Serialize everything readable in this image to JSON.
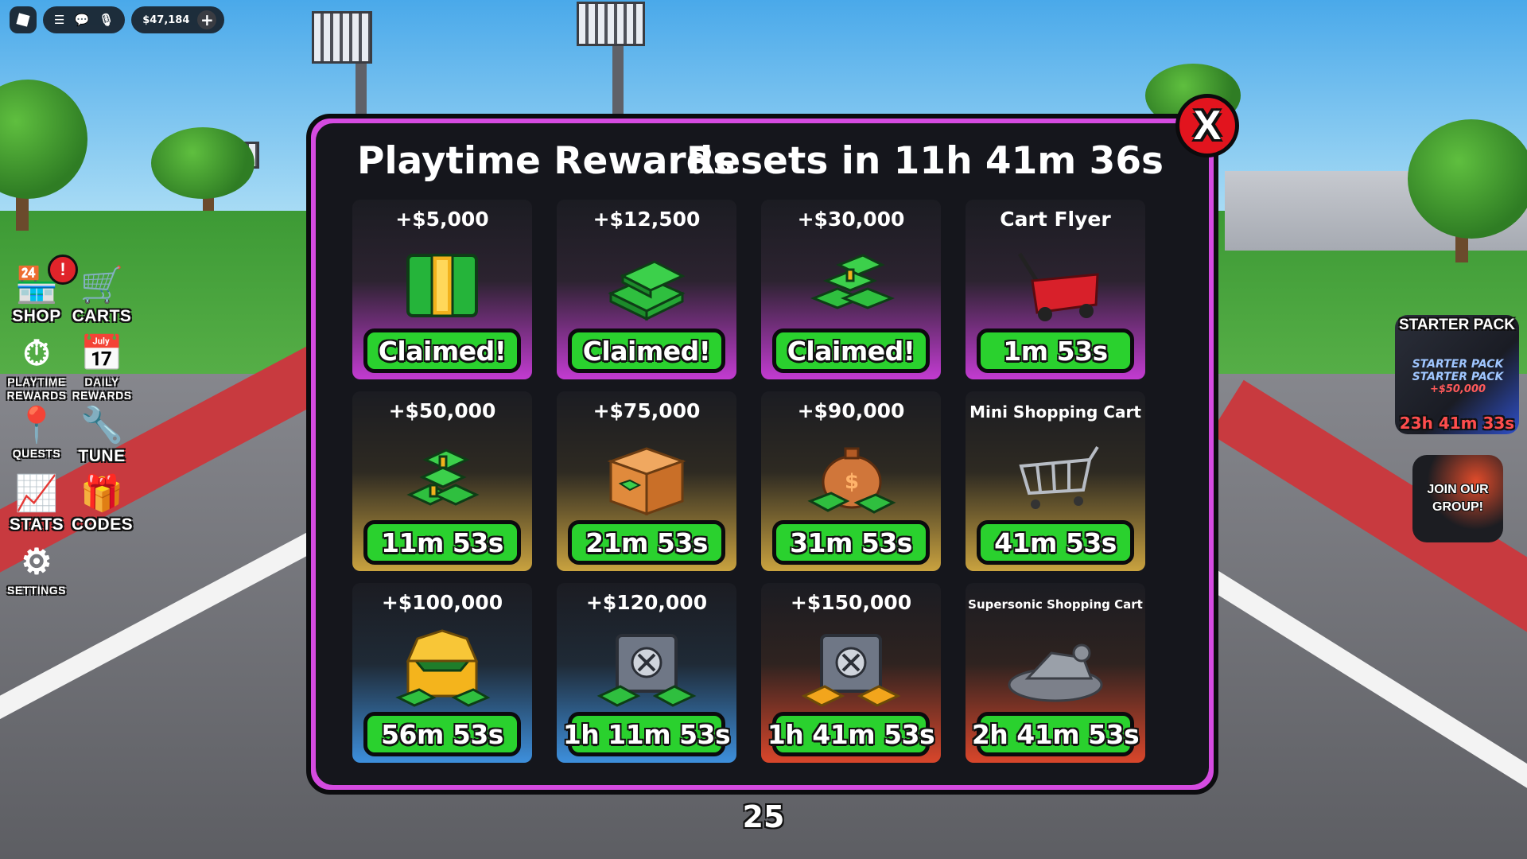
{
  "topbar": {
    "money": "$47,184"
  },
  "menu": {
    "shop": "SHOP",
    "carts": "CARTS",
    "playtime_line1": "PLAYTIME",
    "playtime_line2": "REWARDS",
    "daily_line1": "DAILY",
    "daily_line2": "REWARDS",
    "quests": "QUESTS",
    "tune": "TUNE",
    "stats": "STATS",
    "codes": "CODES",
    "settings": "SETTINGS",
    "shop_alert": "!"
  },
  "promos": {
    "starter_title": "STARTER PACK",
    "starter_banner_1": "STARTER PACK",
    "starter_banner_2": "STARTER PACK",
    "starter_amount": "+$50,000",
    "starter_timer": "23h 41m 33s",
    "join_line1": "JOIN OUR",
    "join_line2": "GROUP!"
  },
  "modal": {
    "title": "Playtime Rewards",
    "reset": "Resets in 11h 41m 36s",
    "close_label": "X",
    "rewards": [
      {
        "label": "+$5,000",
        "status": "Claimed!",
        "tier": "purple",
        "icon": "cash-bill-icon"
      },
      {
        "label": "+$12,500",
        "status": "Claimed!",
        "tier": "purple",
        "icon": "cash-stack-icon"
      },
      {
        "label": "+$30,000",
        "status": "Claimed!",
        "tier": "purple",
        "icon": "cash-pile-icon"
      },
      {
        "label": "Cart Flyer",
        "status": "1m 53s",
        "tier": "purple",
        "icon": "wagon-icon"
      },
      {
        "label": "+$50,000",
        "status": "11m 53s",
        "tier": "gold",
        "icon": "cash-tower-icon"
      },
      {
        "label": "+$75,000",
        "status": "21m 53s",
        "tier": "gold",
        "icon": "cash-box-icon"
      },
      {
        "label": "+$90,000",
        "status": "31m 53s",
        "tier": "gold",
        "icon": "money-bag-icon"
      },
      {
        "label": "Mini Shopping Cart",
        "status": "41m 53s",
        "tier": "gold",
        "icon": "shopping-cart-icon"
      },
      {
        "label": "+$100,000",
        "status": "56m 53s",
        "tier": "blue",
        "icon": "treasure-chest-icon"
      },
      {
        "label": "+$120,000",
        "status": "1h 11m 53s",
        "tier": "blue",
        "icon": "safe-icon"
      },
      {
        "label": "+$150,000",
        "status": "1h 41m 53s",
        "tier": "red",
        "icon": "gold-safe-icon"
      },
      {
        "label": "Supersonic Shopping Cart",
        "status": "2h 41m 53s",
        "tier": "red",
        "icon": "hover-cart-icon"
      }
    ]
  },
  "page_number": "25",
  "colors": {
    "frame": "#d54be1",
    "button_green": "#2ad12e",
    "close_red": "#e2141e"
  }
}
